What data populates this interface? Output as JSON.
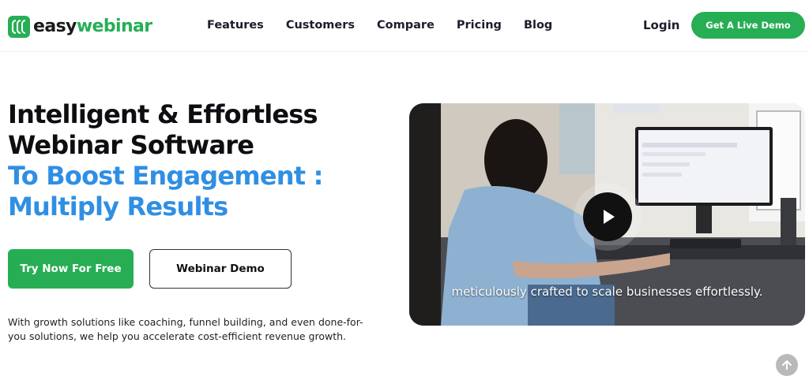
{
  "brand": {
    "name_part1": "easy",
    "name_part2": "webinar",
    "color": "#27ae55"
  },
  "nav": {
    "items": [
      {
        "label": "Features"
      },
      {
        "label": "Customers"
      },
      {
        "label": "Compare"
      },
      {
        "label": "Pricing"
      },
      {
        "label": "Blog"
      }
    ],
    "login_label": "Login",
    "cta_label": "Get A Live Demo"
  },
  "hero": {
    "title_line1": "Intelligent & Effortless",
    "title_line2": "Webinar Software",
    "title_line3": "To Boost Engagement :",
    "title_line4": "Multiply Results",
    "accent_color": "#2f8fe3",
    "primary_button": "Try Now For Free",
    "secondary_button": "Webinar Demo",
    "description": "With growth solutions like coaching, funnel building, and even done-for-you solutions, we help you accelerate cost-efficient revenue growth."
  },
  "video": {
    "caption": "meticulously crafted to scale businesses effortlessly.",
    "play_icon": "play-icon"
  },
  "scroll_top": {
    "icon": "arrow-up-icon"
  }
}
